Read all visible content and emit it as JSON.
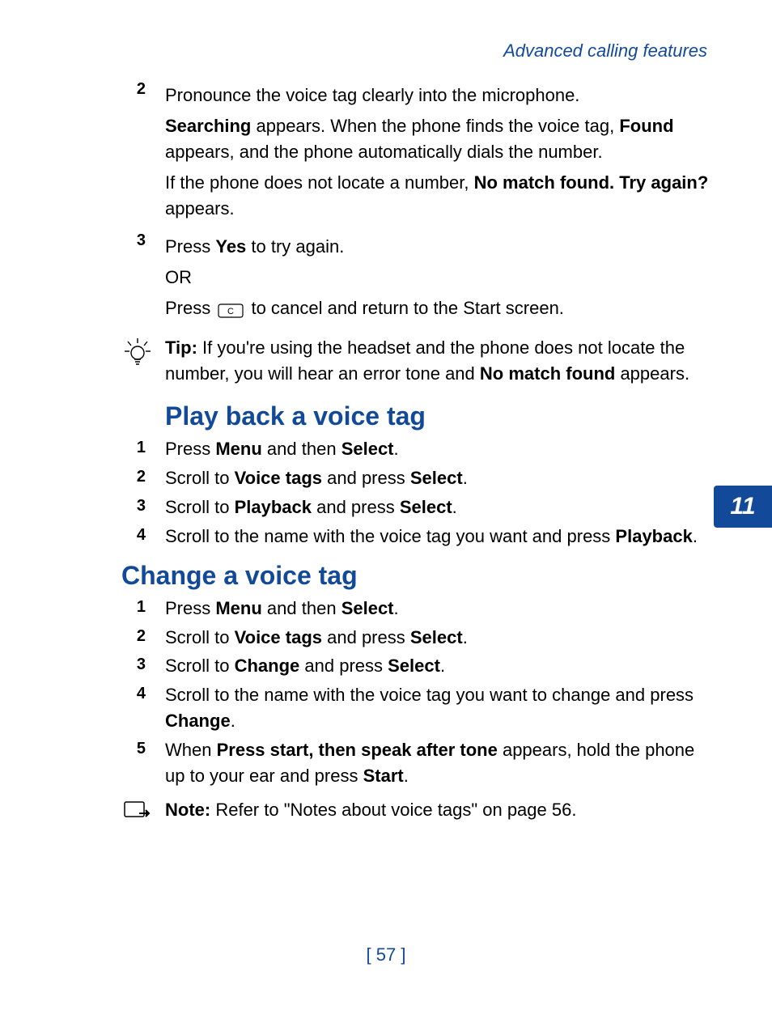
{
  "header": "Advanced calling features",
  "section_tab": "11",
  "page_number": "[ 57 ]",
  "intro_steps": {
    "step2": {
      "num": "2",
      "line1": "Pronounce the voice tag clearly into the microphone.",
      "line2a": "Searching",
      "line2b": " appears. When the phone finds the voice tag, ",
      "line2c": "Found",
      "line2d": " appears, and the phone automatically dials the number.",
      "line3a": "If the phone does not locate a number, ",
      "line3b": "No match found. Try again?",
      "line3c": " appears."
    },
    "step3": {
      "num": "3",
      "line1a": "Press ",
      "line1b": "Yes",
      "line1c": " to try again.",
      "line2": "OR",
      "line3a": "Press ",
      "line3b": " to cancel and return to the Start screen."
    }
  },
  "tip": {
    "label": "Tip:",
    "text_a": " If you're using the headset and the phone does not locate the number, you will hear an error tone and ",
    "text_b": "No match found",
    "text_c": " appears."
  },
  "playback": {
    "title": "Play back a voice tag",
    "steps": [
      {
        "num": "1",
        "pre": "Press ",
        "b1": "Menu",
        "mid": " and then ",
        "b2": "Select",
        "post": "."
      },
      {
        "num": "2",
        "pre": "Scroll to ",
        "b1": "Voice tags",
        "mid": " and press ",
        "b2": "Select",
        "post": "."
      },
      {
        "num": "3",
        "pre": "Scroll to ",
        "b1": "Playback",
        "mid": " and press ",
        "b2": "Select",
        "post": "."
      },
      {
        "num": "4",
        "pre": "Scroll to the name with the voice tag you want and press ",
        "b1": "Playback",
        "mid": "",
        "b2": "",
        "post": "."
      }
    ]
  },
  "change": {
    "title": "Change a voice tag",
    "steps": [
      {
        "num": "1",
        "pre": "Press ",
        "b1": "Menu",
        "mid": " and then ",
        "b2": "Select",
        "post": "."
      },
      {
        "num": "2",
        "pre": "Scroll to ",
        "b1": "Voice tags",
        "mid": " and press ",
        "b2": "Select",
        "post": "."
      },
      {
        "num": "3",
        "pre": "Scroll to ",
        "b1": "Change",
        "mid": " and press ",
        "b2": "Select",
        "post": "."
      },
      {
        "num": "4",
        "pre": "Scroll to the name with the voice tag you want to change and press ",
        "b1": "Change",
        "mid": "",
        "b2": "",
        "post": "."
      },
      {
        "num": "5",
        "pre": "When ",
        "b1": "Press start, then speak after tone",
        "mid": " appears, hold the phone up to your ear and press ",
        "b2": "Start",
        "post": "."
      }
    ]
  },
  "note": {
    "label": "Note:",
    "text": " Refer to \"Notes about voice tags\" on page 56."
  }
}
